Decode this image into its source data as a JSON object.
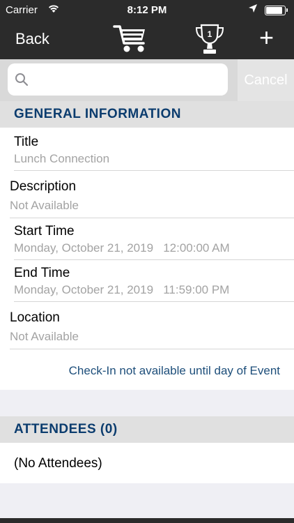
{
  "status_bar": {
    "carrier": "Carrier",
    "time": "8:12 PM",
    "battery_level": 0.9
  },
  "nav": {
    "back_label": "Back",
    "cart_icon": "shopping-cart-icon",
    "trophy_icon": "trophy-icon",
    "trophy_badge": "1",
    "add_icon": "plus-icon"
  },
  "search": {
    "placeholder": "",
    "value": "",
    "cancel_label": "Cancel"
  },
  "general": {
    "header": "GENERAL INFORMATION",
    "title_label": "Title",
    "title_value": "Lunch Connection",
    "description_label": "Description",
    "description_value": "Not Available",
    "start_label": "Start Time",
    "start_value": "Monday, October 21, 2019   12:00:00 AM",
    "end_label": "End Time",
    "end_value": "Monday, October 21, 2019   11:59:00 PM",
    "location_label": "Location",
    "location_value": "Not Available",
    "checkin_note": "Check-In not available until day of Event"
  },
  "attendees": {
    "header": "ATTENDEES (0)",
    "empty_text": "(No Attendees)"
  },
  "colors": {
    "nav_bg": "#2b2b2b",
    "header_text": "#0b3c6e",
    "link_text": "#1d4e7a"
  }
}
